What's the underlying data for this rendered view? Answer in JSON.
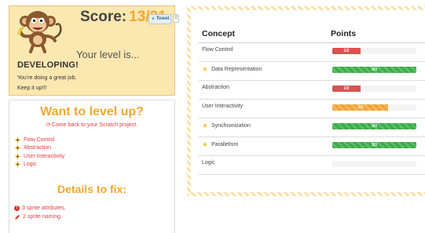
{
  "score": {
    "label": "Score:",
    "value": "13/21",
    "tweet_label": "Tweet",
    "tweet_count": "0",
    "level_prompt": "Your level is...",
    "level": "DEVELOPING!",
    "message_line1": "You're doing a great job.",
    "message_line2": "Keep it up!!!"
  },
  "level_up": {
    "title": "Want to level up?",
    "subtitle": "Come back to your Scratch project.",
    "items": [
      "Flow Control",
      "Abstraction",
      "User Interactivity",
      "Logic"
    ]
  },
  "details": {
    "title": "Details to fix:",
    "items": [
      {
        "icon": "alert-icon",
        "text": "3 sprite attributes."
      },
      {
        "icon": "pencil-icon",
        "text": "2 sprite naming."
      }
    ]
  },
  "table": {
    "header_concept": "Concept",
    "header_points": "Points",
    "rows": [
      {
        "concept": "Flow Control",
        "starred": false,
        "score": "1/3",
        "fraction": 0.333,
        "color": "red"
      },
      {
        "concept": "Data Representation",
        "starred": true,
        "score": "3/3",
        "fraction": 1.0,
        "color": "green"
      },
      {
        "concept": "Abstraction",
        "starred": false,
        "score": "1/3",
        "fraction": 0.333,
        "color": "red"
      },
      {
        "concept": "User Interactivity",
        "starred": false,
        "score": "2/3",
        "fraction": 0.667,
        "color": "orange"
      },
      {
        "concept": "Synchronization",
        "starred": true,
        "score": "3/3",
        "fraction": 1.0,
        "color": "green"
      },
      {
        "concept": "Parallelism",
        "starred": true,
        "score": "3/3",
        "fraction": 1.0,
        "color": "green"
      },
      {
        "concept": "Logic",
        "starred": false,
        "score": "",
        "fraction": 0,
        "color": "none"
      }
    ]
  },
  "colors": {
    "accent_orange": "#f0a830",
    "alert_red": "#e03d3d",
    "bar_green": "#3fa94a",
    "bar_red": "#d9534f",
    "bar_orange": "#eea236",
    "score_card_bg": "#fbe7b0"
  }
}
